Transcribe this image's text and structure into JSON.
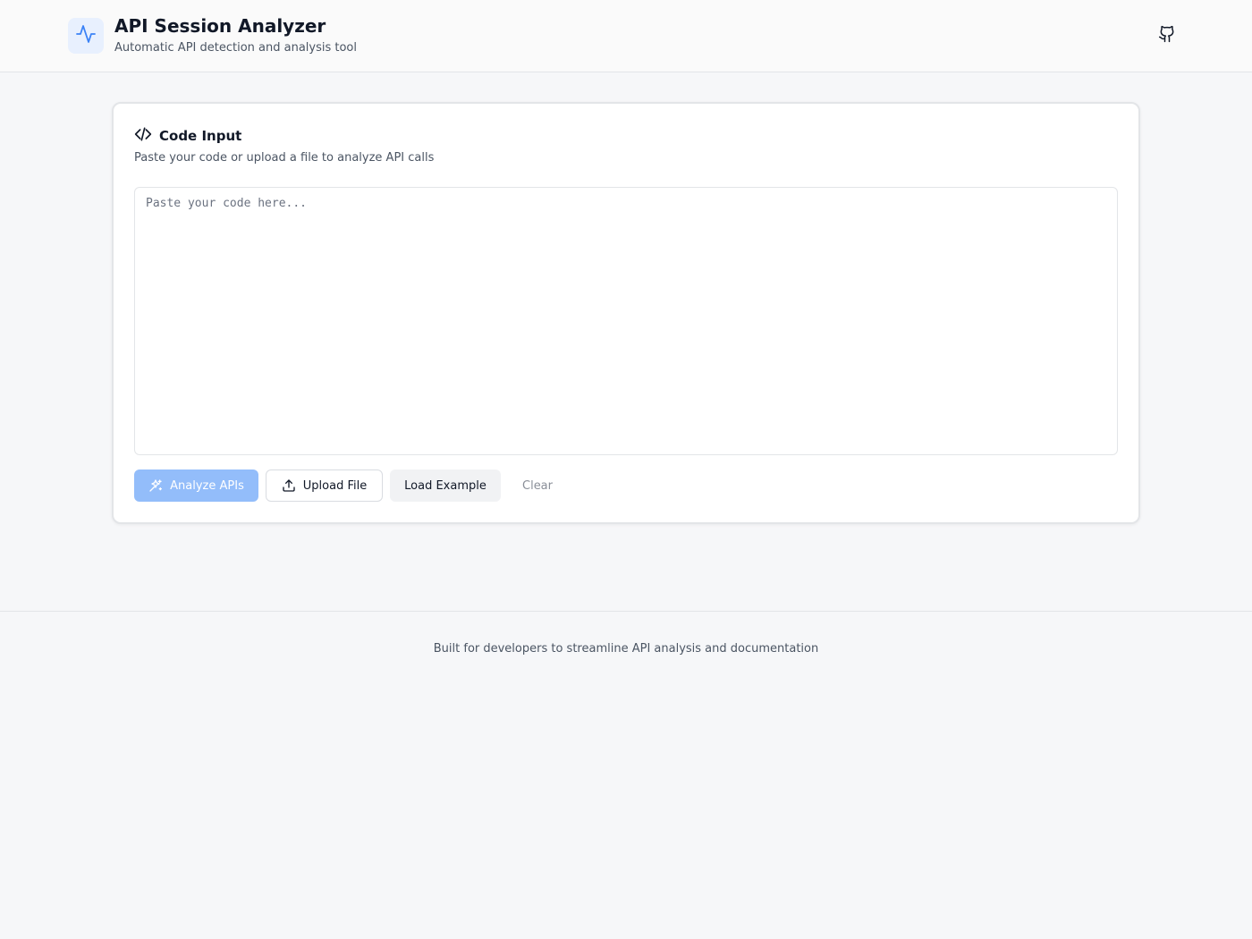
{
  "header": {
    "title": "API Session Analyzer",
    "subtitle": "Automatic API detection and analysis tool",
    "logo_icon": "activity-icon",
    "github_icon": "github-icon"
  },
  "code_input": {
    "title": "Code Input",
    "title_icon": "code-icon",
    "description": "Paste your code or upload a file to analyze API calls",
    "placeholder": "Paste your code here...",
    "value": ""
  },
  "actions": {
    "analyze_label": "Analyze APIs",
    "analyze_icon": "sparkles-icon",
    "upload_label": "Upload File",
    "upload_icon": "upload-icon",
    "example_label": "Load Example",
    "clear_label": "Clear"
  },
  "footer": {
    "text": "Built for developers to streamline API analysis and documentation"
  },
  "colors": {
    "accent": "#3b82f6",
    "analyze_disabled": "#93bdfa",
    "logo_bg": "#e8f0fe"
  }
}
